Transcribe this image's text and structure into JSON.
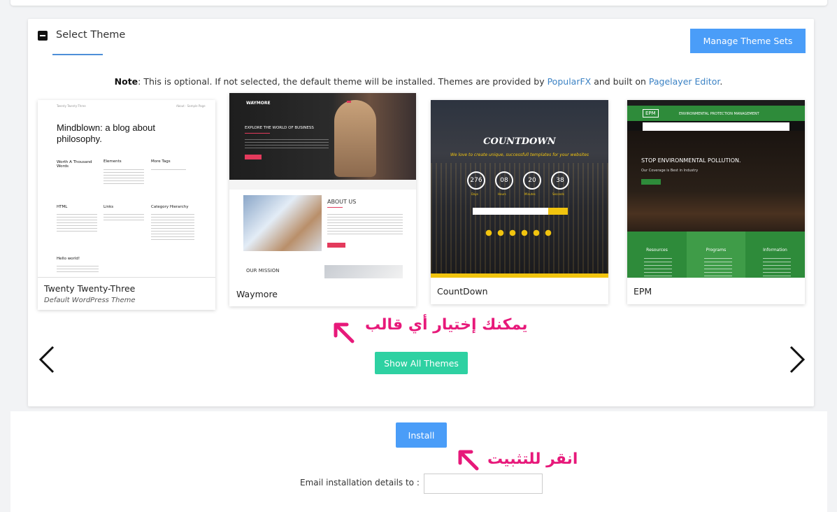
{
  "section": {
    "title": "Select Theme",
    "manage_button": "Manage Theme Sets"
  },
  "note": {
    "label": "Note",
    "text_before": ": This is optional. If not selected, the default theme will be installed. Themes are provided by ",
    "link1": "PopularFX",
    "text_middle": " and built on ",
    "link2": "Pagelayer Editor",
    "text_after": "."
  },
  "themes": [
    {
      "name": "Twenty Twenty-Three",
      "subtitle": "Default WordPress Theme",
      "preview": {
        "headline": "Mindblown: a blog about philosophy.",
        "items": [
          "Worth A Thousand Words",
          "Elements",
          "More Tags",
          "HTML",
          "Links",
          "Category Hierarchy",
          "Hello world!"
        ]
      }
    },
    {
      "name": "Waymore",
      "preview": {
        "brand": "WAYMORE",
        "hero": "EXPLORE THE WORLD OF BUSINESS",
        "about": "ABOUT US",
        "mission": "OUR MISSION"
      }
    },
    {
      "name": "CountDown",
      "preview": {
        "heading": "COUNTDOWN",
        "tagline": "We love to create unique, successfull templates for your websites",
        "counters": [
          {
            "value": "276",
            "label": "Days"
          },
          {
            "value": "08",
            "label": "Hours"
          },
          {
            "value": "20",
            "label": "Minutes"
          },
          {
            "value": "38",
            "label": "Seconds"
          }
        ]
      }
    },
    {
      "name": "EPM",
      "preview": {
        "logo": "EPM",
        "banner": "ENVIRONMENTAL PROTECTION MANAGEMENT",
        "hero": "STOP ENVIRONMENTAL POLLUTION.",
        "sub": "Our Coverage is Best in Industry",
        "columns": [
          "Resources",
          "Programs",
          "Information"
        ]
      }
    }
  ],
  "show_all_button": "Show All Themes",
  "annotation_choose": "يمكنك إختيار أي قالب",
  "install_button": "Install",
  "annotation_install": "انقر للتثبيت",
  "email_label": "Email installation details to :",
  "email_value": "",
  "colors": {
    "primary_blue": "#4a9df8",
    "teal": "#2ed1a2",
    "annotation_pink": "#e7197a",
    "link_blue": "#3b82c4"
  }
}
